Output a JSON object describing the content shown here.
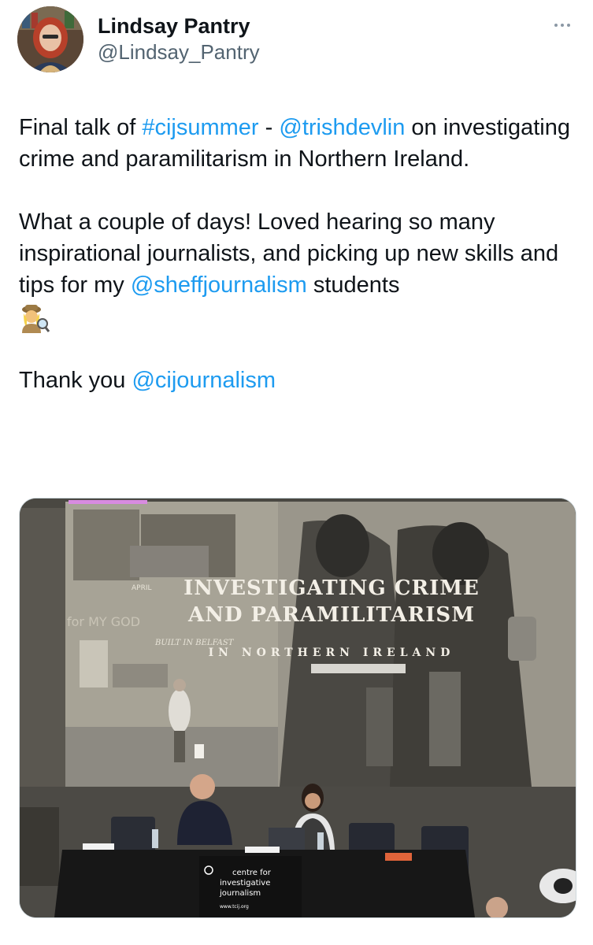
{
  "author": {
    "display_name": "Lindsay Pantry",
    "handle": "@Lindsay_Pantry"
  },
  "tweet": {
    "p1": {
      "t1": "Final talk of ",
      "hashtag": "#cijsummer",
      "t2": " - ",
      "mention": "@trishdevlin",
      "t3": " on investigating crime and paramilitarism in Northern Ireland."
    },
    "p2": {
      "t1": "What a couple of days! Loved hearing so many inspirational journalists, and picking up new skills and tips for my ",
      "mention": "@sheffjournalism",
      "t2": " students"
    },
    "p3": {
      "t1": "Thank you ",
      "mention": "@cijournalism"
    }
  },
  "media": {
    "slide_line1": "INVESTIGATING CRIME",
    "slide_line2": "AND PARAMILITARISM",
    "slide_line3": "IN NORTHERN IRELAND",
    "mural_text1": "APRIL",
    "mural_text2": "BUILT IN BELFAST",
    "mural_text3": "for MY GOD",
    "banner_line1": "centre for",
    "banner_line2": "investigative",
    "banner_line3": "journalism",
    "banner_url": "www.tcij.org"
  },
  "colors": {
    "link": "#1d9bf0",
    "handle": "#536471",
    "text": "#0f1419"
  },
  "icons": {
    "more": "more-icon",
    "emoji": "detective-emoji-icon"
  }
}
